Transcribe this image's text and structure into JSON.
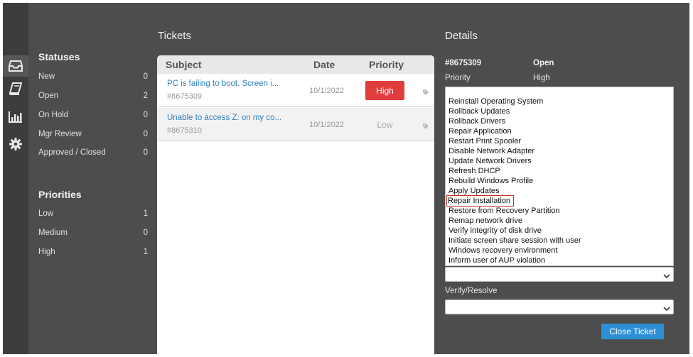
{
  "iconbar": {
    "items": [
      {
        "icon": "inbox-icon"
      },
      {
        "icon": "book-icon"
      },
      {
        "icon": "bar-chart-icon"
      },
      {
        "icon": "gear-icon"
      }
    ]
  },
  "statuses": {
    "title": "Statuses",
    "items": [
      {
        "label": "New",
        "count": "0"
      },
      {
        "label": "Open",
        "count": "2"
      },
      {
        "label": "On Hold",
        "count": "0"
      },
      {
        "label": "Mgr Review",
        "count": "0"
      },
      {
        "label": "Approved / Closed",
        "count": "0"
      }
    ]
  },
  "priorities": {
    "title": "Priorities",
    "items": [
      {
        "label": "Low",
        "count": "1"
      },
      {
        "label": "Medium",
        "count": "0"
      },
      {
        "label": "High",
        "count": "1"
      }
    ]
  },
  "tickets": {
    "title": "Tickets",
    "columns": {
      "subject": "Subject",
      "date": "Date",
      "priority": "Priority"
    },
    "rows": [
      {
        "subject": "PC is failing to boot. Screen i...",
        "id": "#8675309",
        "date": "10/1/2022",
        "priority": "High"
      },
      {
        "subject": "Unable to access Z: on my co...",
        "id": "#8675310",
        "date": "10/1/2022",
        "priority": "Low"
      }
    ]
  },
  "details": {
    "title": "Details",
    "ticket_id": "#8675309",
    "status": "Open",
    "priority_label": "Priority",
    "priority_value": "High",
    "actions": [
      "Reinstall Operating System",
      "Rollback Updates",
      "Rollback Drivers",
      "Repair Application",
      "Restart Print Spooler",
      "Disable Network Adapter",
      "Update Network Drivers",
      "Refresh DHCP",
      "Rebuild Windows Profile",
      "Apply Updates",
      "Repair Installation",
      "Restore from Recovery Partition",
      "Remap network drive",
      "Verify integrity of disk drive",
      "Initiate screen share session with user",
      "Windows recovery environment",
      "Inform user of AUP violation"
    ],
    "highlighted_action": "Repair Installation",
    "action_select_value": "",
    "verify_label": "Verify/Resolve",
    "verify_select_value": "",
    "close_button": "Close Ticket"
  },
  "colors": {
    "background": "#4d4d4d",
    "iconbar": "#3d3d3d",
    "high_priority": "#e03d3d",
    "link": "#2f7fbd",
    "button": "#2e8fd6"
  }
}
